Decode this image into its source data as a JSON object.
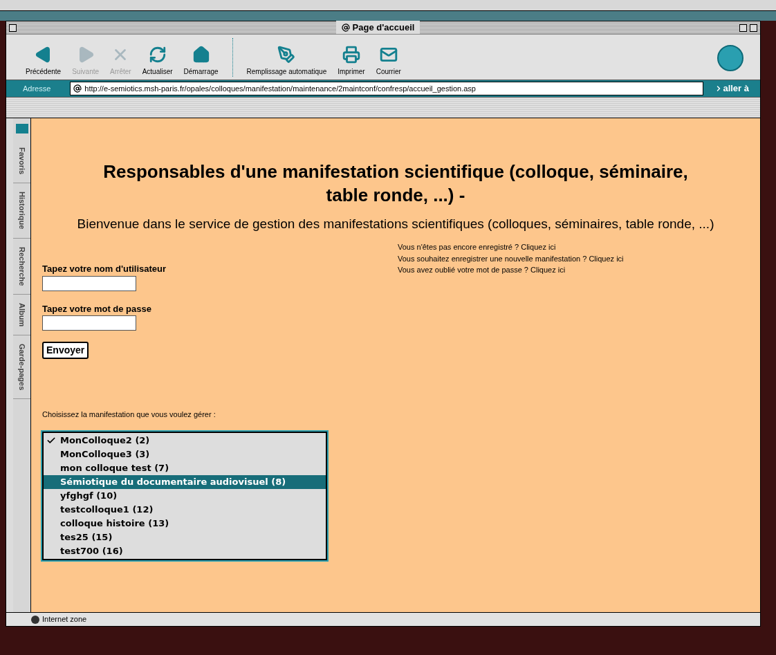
{
  "window": {
    "title": "Page d'accueil"
  },
  "toolbar": [
    {
      "kind": "back",
      "label": "Précédente",
      "disabled": false
    },
    {
      "kind": "forward",
      "label": "Suivante",
      "disabled": true
    },
    {
      "kind": "stop",
      "label": "Arrêter",
      "disabled": true
    },
    {
      "kind": "refresh",
      "label": "Actualiser",
      "disabled": false
    },
    {
      "kind": "home",
      "label": "Démarrage",
      "disabled": false
    },
    {
      "kind": "autofill",
      "label": "Remplissage automatique",
      "disabled": false
    },
    {
      "kind": "print",
      "label": "Imprimer",
      "disabled": false
    },
    {
      "kind": "mail",
      "label": "Courrier",
      "disabled": false
    }
  ],
  "address_bar": {
    "label": "Adresse",
    "value": "http://e-semiotics.msh-paris.fr/opales/colloques/manifestation/maintenance/2maintconf/confresp/accueil_gestion.asp",
    "go": "aller à"
  },
  "sidebar": {
    "tabs": [
      "Favoris",
      "Historique",
      "Recherche",
      "Album",
      "Garde-pages"
    ]
  },
  "page": {
    "heading": "Responsables d'une manifestation scientifique (colloque, séminaire, table ronde, ...) -",
    "subheading": "Bienvenue dans le service de gestion des manifestations scientifiques (colloques, séminaires, table ronde, ...)",
    "links": [
      {
        "text": "Vous n'êtes pas encore enregistré ?",
        "link": "Cliquez ici"
      },
      {
        "text": "Vous souhaitez enregistrer une nouvelle manifestation ?",
        "link": "Cliquez ici"
      },
      {
        "text": "Vous avez oublié votre mot de passe ?",
        "link": "Cliquez ici"
      }
    ],
    "username_label": "Tapez votre nom d'utilisateur",
    "password_label": "Tapez votre mot de passe",
    "submit": "Envoyer",
    "choose_label": "Choisissez la manifestation que vous voulez gérer :",
    "options": [
      {
        "label": "MonColloque2 (2)",
        "checked": true,
        "selected": false
      },
      {
        "label": "MonColloque3 (3)",
        "checked": false,
        "selected": false
      },
      {
        "label": "mon colloque test (7)",
        "checked": false,
        "selected": false
      },
      {
        "label": "Sémiotique du documentaire audiovisuel (8)",
        "checked": false,
        "selected": true
      },
      {
        "label": "yfghgf (10)",
        "checked": false,
        "selected": false
      },
      {
        "label": "testcolloque1 (12)",
        "checked": false,
        "selected": false
      },
      {
        "label": "colloque histoire (13)",
        "checked": false,
        "selected": false
      },
      {
        "label": "tes25 (15)",
        "checked": false,
        "selected": false
      },
      {
        "label": "test700 (16)",
        "checked": false,
        "selected": false
      }
    ]
  },
  "status_bar": {
    "zone": "Internet zone"
  }
}
